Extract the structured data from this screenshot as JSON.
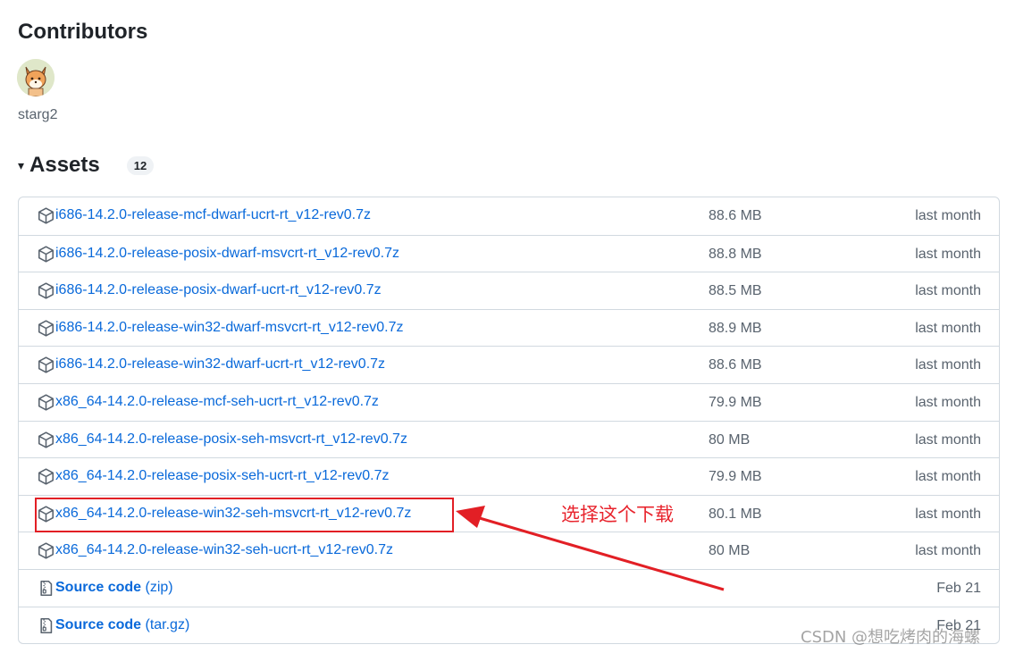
{
  "contributors": {
    "title": "Contributors",
    "people": [
      {
        "username": "starg2"
      }
    ]
  },
  "assets": {
    "caret": "▾",
    "title": "Assets",
    "count": "12",
    "items": [
      {
        "name": "i686-14.2.0-release-mcf-dwarf-ucrt-rt_v12-rev0.7z",
        "suffix": "",
        "size": "88.6 MB",
        "date": "last month",
        "icon": "package-icon"
      },
      {
        "name": "i686-14.2.0-release-posix-dwarf-msvcrt-rt_v12-rev0.7z",
        "suffix": "",
        "size": "88.8 MB",
        "date": "last month",
        "icon": "package-icon"
      },
      {
        "name": "i686-14.2.0-release-posix-dwarf-ucrt-rt_v12-rev0.7z",
        "suffix": "",
        "size": "88.5 MB",
        "date": "last month",
        "icon": "package-icon"
      },
      {
        "name": "i686-14.2.0-release-win32-dwarf-msvcrt-rt_v12-rev0.7z",
        "suffix": "",
        "size": "88.9 MB",
        "date": "last month",
        "icon": "package-icon"
      },
      {
        "name": "i686-14.2.0-release-win32-dwarf-ucrt-rt_v12-rev0.7z",
        "suffix": "",
        "size": "88.6 MB",
        "date": "last month",
        "icon": "package-icon"
      },
      {
        "name": "x86_64-14.2.0-release-mcf-seh-ucrt-rt_v12-rev0.7z",
        "suffix": "",
        "size": "79.9 MB",
        "date": "last month",
        "icon": "package-icon"
      },
      {
        "name": "x86_64-14.2.0-release-posix-seh-msvcrt-rt_v12-rev0.7z",
        "suffix": "",
        "size": "80 MB",
        "date": "last month",
        "icon": "package-icon"
      },
      {
        "name": "x86_64-14.2.0-release-posix-seh-ucrt-rt_v12-rev0.7z",
        "suffix": "",
        "size": "79.9 MB",
        "date": "last month",
        "icon": "package-icon"
      },
      {
        "name": "x86_64-14.2.0-release-win32-seh-msvcrt-rt_v12-rev0.7z",
        "suffix": "",
        "size": "80.1 MB",
        "date": "last month",
        "icon": "package-icon"
      },
      {
        "name": "x86_64-14.2.0-release-win32-seh-ucrt-rt_v12-rev0.7z",
        "suffix": "",
        "size": "80 MB",
        "date": "last month",
        "icon": "package-icon"
      },
      {
        "name": "Source code",
        "suffix": "(zip)",
        "size": "",
        "date": "Feb 21",
        "icon": "file-zip-icon"
      },
      {
        "name": "Source code",
        "suffix": "(tar.gz)",
        "size": "",
        "date": "Feb 21",
        "icon": "file-zip-icon"
      }
    ]
  },
  "annotation": {
    "text": "选择这个下载",
    "color": "#e8242d"
  },
  "watermark": "CSDN @想吃烤肉的海螺",
  "colors": {
    "link": "#0969da",
    "muted": "#59636e",
    "border": "#d1d9e0",
    "annotation_red": "#e21f25"
  }
}
